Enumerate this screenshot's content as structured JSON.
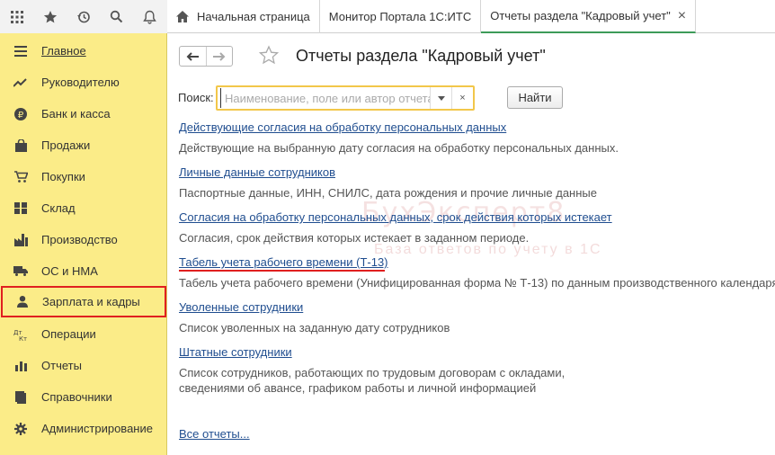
{
  "tabs": [
    {
      "label": "Начальная страница"
    },
    {
      "label": "Монитор Портала 1С:ИТС"
    },
    {
      "label": "Отчеты раздела \"Кадровый учет\""
    }
  ],
  "sidebar": {
    "items": [
      {
        "label": "Главное"
      },
      {
        "label": "Руководителю"
      },
      {
        "label": "Банк и касса"
      },
      {
        "label": "Продажи"
      },
      {
        "label": "Покупки"
      },
      {
        "label": "Склад"
      },
      {
        "label": "Производство"
      },
      {
        "label": "ОС и НМА"
      },
      {
        "label": "Зарплата и кадры"
      },
      {
        "label": "Операции"
      },
      {
        "label": "Отчеты"
      },
      {
        "label": "Справочники"
      },
      {
        "label": "Администрирование"
      }
    ]
  },
  "page": {
    "title": "Отчеты раздела \"Кадровый учет\"",
    "search_label": "Поиск:",
    "search_placeholder": "Наименование, поле или автор отчета",
    "search_value": "",
    "find_button": "Найти",
    "close_glyph": "×",
    "all_reports": "Все отчеты..."
  },
  "reports": [
    {
      "title": "Действующие согласия на обработку персональных данных",
      "desc": "Действующие на выбранную дату согласия на обработку персональных данных."
    },
    {
      "title": "Личные данные сотрудников",
      "desc": "Паспортные данные, ИНН, СНИЛС, дата рождения и прочие личные данные"
    },
    {
      "title": "Согласия на обработку персональных данных, срок действия которых истекает",
      "desc": "Согласия, срок действия которых истекает в заданном периоде."
    },
    {
      "title": "Табель учета рабочего времени (Т-13)",
      "desc": "Табель учета рабочего времени (Унифицированная форма № Т-13) по данным производственного календаря"
    },
    {
      "title": "Уволенные сотрудники",
      "desc": "Список уволенных на заданную дату сотрудников"
    },
    {
      "title": "Штатные сотрудники",
      "desc": "Список сотрудников, работающих по трудовым договорам с окладами, сведениями об авансе, графиком работы и личной информацией"
    }
  ],
  "watermark": {
    "line1": "БухЭксперт8",
    "line2": "База ответов по учету в 1С"
  },
  "colors": {
    "sidebar": "#fbec88",
    "link": "#1f4d8f",
    "highlight": "#e02020",
    "search_border": "#f2c74a"
  }
}
